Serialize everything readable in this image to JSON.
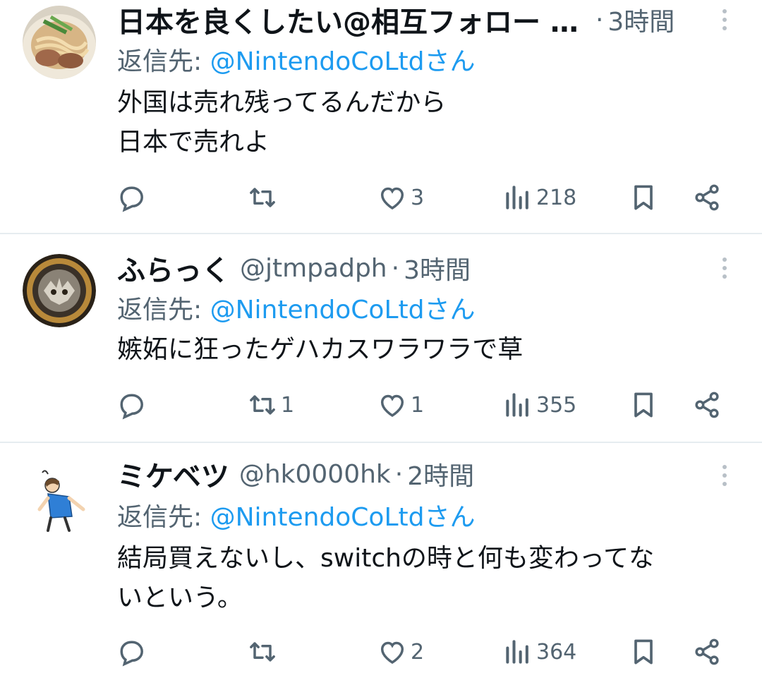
{
  "tweets": [
    {
      "name": "日本を良くしたい@相互フォロー …",
      "handle": "",
      "separator": "·",
      "time": "3時間",
      "reply_prefix": "返信先: ",
      "reply_mention": "@NintendoCoLtdさん",
      "text": "外国は売れ残ってるんだから\n日本で売れよ",
      "avatar": "ramen-food-photo",
      "counts": {
        "reply": "",
        "retweet": "",
        "like": "3",
        "views": "218"
      }
    },
    {
      "name": "ふらっく",
      "handle": "@jtmpadph",
      "separator": "·",
      "time": "3時間",
      "reply_prefix": "返信先: ",
      "reply_mention": "@NintendoCoLtdさん",
      "text": "嫉妬に狂ったゲハカスワラワラで草",
      "avatar": "round-emblem-badge",
      "counts": {
        "reply": "",
        "retweet": "1",
        "like": "1",
        "views": "355"
      }
    },
    {
      "name": "ミケベツ",
      "handle": "@hk0000hk",
      "separator": "·",
      "time": "2時間",
      "reply_prefix": "返信先: ",
      "reply_mention": "@NintendoCoLtdさん",
      "text": "結局買えないし、switchの時と何も変わってな\nいという。",
      "avatar": "cartoon-person-illustration",
      "counts": {
        "reply": "",
        "retweet": "",
        "like": "2",
        "views": "364"
      }
    }
  ],
  "colors": {
    "text": "#0f1419",
    "secondary": "#536471",
    "accent": "#1d9bf0",
    "divider": "#e6ecf0"
  },
  "icons": [
    "reply-icon",
    "retweet-icon",
    "like-icon",
    "views-icon",
    "bookmark-icon",
    "share-icon",
    "more-icon"
  ]
}
